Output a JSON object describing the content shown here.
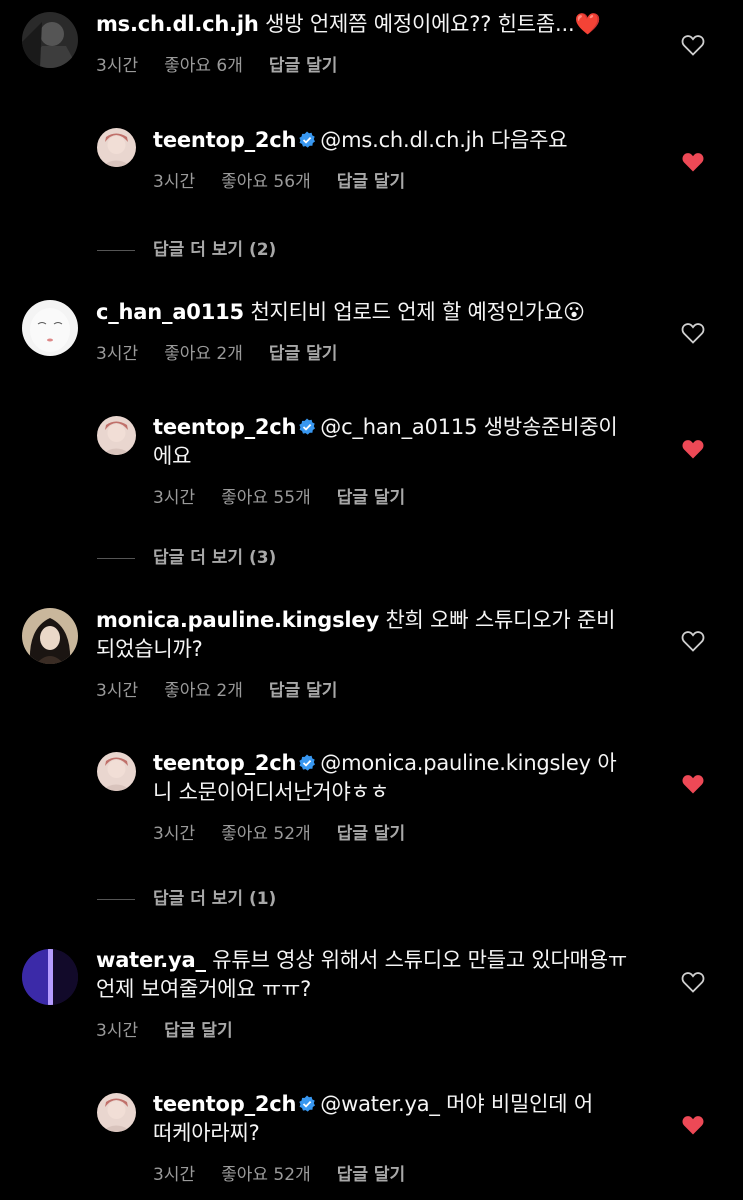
{
  "colors": {
    "background": "#000000",
    "meta": "#9a9a9a",
    "liked_heart": "#ed4956",
    "verified": "#3897f0"
  },
  "threads": [
    {
      "comment": {
        "username": "ms.ch.dl.ch.jh",
        "text": "생방 언제쯤 예정이에요?? 힌트좀...❤️",
        "time": "3시간",
        "likes": "좋아요 6개",
        "reply": "답글 달기",
        "liked": false
      },
      "reply": {
        "username": "teentop_2ch",
        "text": "@ms.ch.dl.ch.jh 다음주요",
        "time": "3시간",
        "likes": "좋아요 56개",
        "reply": "답글 달기",
        "liked": true
      },
      "more_replies": "답글 더 보기 (2)"
    },
    {
      "comment": {
        "username": "c_han_a0115",
        "text": "천지티비 업로드 언제 할 예정인가요😮",
        "time": "3시간",
        "likes": "좋아요 2개",
        "reply": "답글 달기",
        "liked": false
      },
      "reply": {
        "username": "teentop_2ch",
        "text": "@c_han_a0115 생방송준비중이에요",
        "time": "3시간",
        "likes": "좋아요 55개",
        "reply": "답글 달기",
        "liked": true
      },
      "more_replies": "답글 더 보기 (3)"
    },
    {
      "comment": {
        "username": "monica.pauline.kingsley",
        "text": "찬희 오빠 스튜디오가 준비되었습니까?",
        "time": "3시간",
        "likes": "좋아요 2개",
        "reply": "답글 달기",
        "liked": false
      },
      "reply": {
        "username": "teentop_2ch",
        "text": "@monica.pauline.kingsley 아니 소문이어디서난거야ㅎㅎ",
        "time": "3시간",
        "likes": "좋아요 52개",
        "reply": "답글 달기",
        "liked": true
      },
      "more_replies": "답글 더 보기 (1)"
    },
    {
      "comment": {
        "username": "water.ya_",
        "text": "유튜브 영상 위해서 스튜디오 만들고 있다매용ㅠ 언제 보여줄거에요 ㅠㅠ?",
        "time": "3시간",
        "reply": "답글 달기",
        "liked": false
      },
      "reply": {
        "username": "teentop_2ch",
        "text": "@water.ya_ 머야 비밀인데 어떠케아라찌?",
        "time": "3시간",
        "likes": "좋아요 52개",
        "reply": "답글 달기",
        "liked": true
      }
    }
  ]
}
